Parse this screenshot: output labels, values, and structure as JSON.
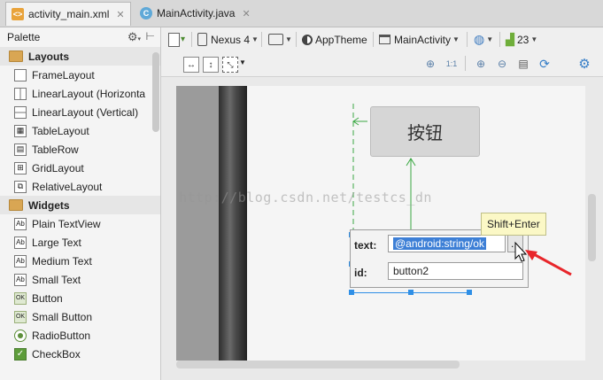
{
  "tabs": [
    {
      "label": "activity_main.xml",
      "icon": "xml-file-icon",
      "active": true
    },
    {
      "label": "MainActivity.java",
      "icon": "java-class-icon",
      "active": false
    }
  ],
  "palette": {
    "title": "Palette",
    "categories": [
      {
        "label": "Layouts",
        "items": [
          "FrameLayout",
          "LinearLayout (Horizonta",
          "LinearLayout (Vertical)",
          "TableLayout",
          "TableRow",
          "GridLayout",
          "RelativeLayout"
        ]
      },
      {
        "label": "Widgets",
        "items": [
          "Plain TextView",
          "Large Text",
          "Medium Text",
          "Small Text",
          "Button",
          "Small Button",
          "RadioButton",
          "CheckBox"
        ]
      }
    ]
  },
  "toolbar": {
    "device": "Nexus 4",
    "theme": "AppTheme",
    "activity": "MainActivity",
    "api": "23"
  },
  "canvas": {
    "button_text": "按钮",
    "watermark": "http://blog.csdn.net/testcs_dn",
    "popup": {
      "text_label": "text:",
      "text_value": "@android:string/ok",
      "browse_label": "...",
      "id_label": "id:",
      "id_value": "button2"
    },
    "tooltip": "Shift+Enter"
  },
  "colors": {
    "selection": "#2f8fe6",
    "annotation_arrow": "#e8262b",
    "constraint": "#3aa843"
  }
}
